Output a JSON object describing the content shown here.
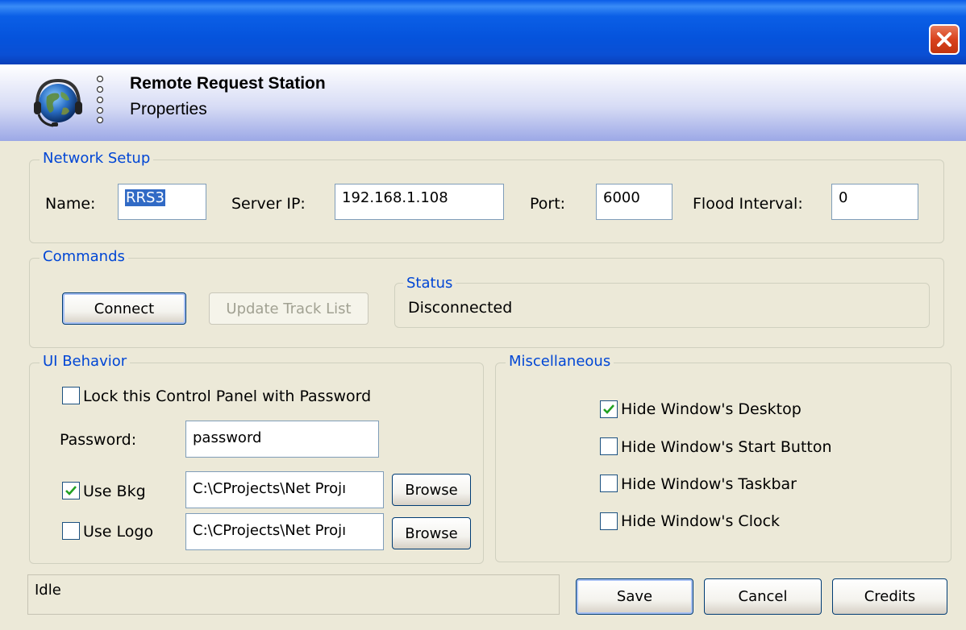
{
  "window": {
    "app_title": "Remote Request Station",
    "app_subtitle": "Properties",
    "icons": [
      "globe-headset-logo-icon",
      "close-icon"
    ]
  },
  "network_setup": {
    "title": "Network Setup",
    "name_label": "Name:",
    "name_value": "RRS3",
    "server_ip_label": "Server IP:",
    "server_ip_value": "192.168.1.108",
    "port_label": "Port:",
    "port_value": "6000",
    "flood_interval_label": "Flood Interval:",
    "flood_interval_value": "0"
  },
  "commands": {
    "title": "Commands",
    "connect_label": "Connect",
    "update_track_list_label": "Update Track List",
    "status": {
      "title": "Status",
      "value": "Disconnected"
    }
  },
  "ui_behavior": {
    "title": "UI Behavior",
    "lock_label": "Lock this Control Panel with Password",
    "lock_checked": false,
    "password_label": "Password:",
    "password_value": "password",
    "use_bkg_label": "Use Bkg",
    "use_bkg_checked": true,
    "bkg_path": "C:\\CProjects\\Net Projı",
    "use_logo_label": "Use Logo",
    "use_logo_checked": false,
    "logo_path": "C:\\CProjects\\Net Projı",
    "browse_label": "Browse"
  },
  "miscellaneous": {
    "title": "Miscellaneous",
    "items": [
      {
        "label": "Hide Window's Desktop",
        "checked": true
      },
      {
        "label": "Hide Window's Start Button",
        "checked": false
      },
      {
        "label": "Hide Window's Taskbar",
        "checked": false
      },
      {
        "label": "Hide Window's Clock",
        "checked": false
      }
    ]
  },
  "footer": {
    "status_text": "Idle",
    "save_label": "Save",
    "cancel_label": "Cancel",
    "credits_label": "Credits"
  },
  "colors": {
    "titlebar_blue": "#0553dc",
    "group_title_blue": "#0046d5",
    "check_green": "#21a121",
    "close_red": "#d9421d"
  }
}
